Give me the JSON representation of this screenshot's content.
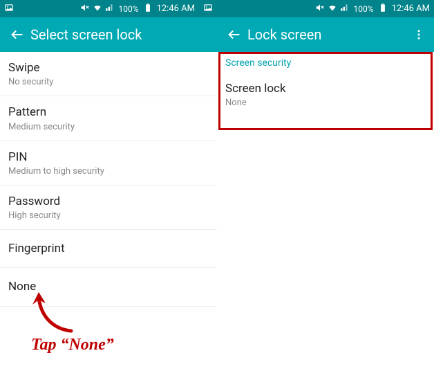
{
  "status": {
    "battery_pct": "100%",
    "time": "12:46 AM"
  },
  "left_screen": {
    "title": "Select screen lock",
    "items": [
      {
        "title": "Swipe",
        "subtitle": "No security"
      },
      {
        "title": "Pattern",
        "subtitle": "Medium security"
      },
      {
        "title": "PIN",
        "subtitle": "Medium to high security"
      },
      {
        "title": "Password",
        "subtitle": "High security"
      },
      {
        "title": "Fingerprint",
        "subtitle": ""
      },
      {
        "title": "None",
        "subtitle": ""
      }
    ]
  },
  "right_screen": {
    "title": "Lock screen",
    "section_header": "Screen security",
    "item": {
      "title": "Screen lock",
      "subtitle": "None"
    }
  },
  "annotation": {
    "tap_text": "Tap “None”"
  }
}
